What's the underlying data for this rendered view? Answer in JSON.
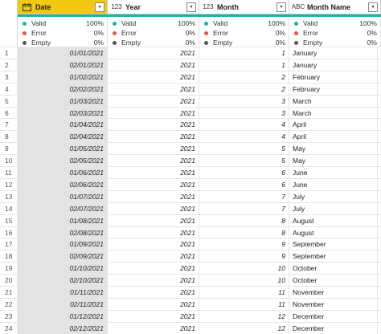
{
  "columns": [
    {
      "name": "Date",
      "type_icon": "calendar-icon",
      "selected": true
    },
    {
      "name": "Year",
      "type_icon": "123",
      "selected": false
    },
    {
      "name": "Month",
      "type_icon": "123",
      "selected": false
    },
    {
      "name": "Month Name",
      "type_icon": "ABC",
      "selected": false
    }
  ],
  "quality_labels": {
    "valid": "Valid",
    "error": "Error",
    "empty": "Empty"
  },
  "quality": [
    {
      "valid": "100%",
      "error": "0%",
      "empty": "0%"
    },
    {
      "valid": "100%",
      "error": "0%",
      "empty": "0%"
    },
    {
      "valid": "100%",
      "error": "0%",
      "empty": "0%"
    },
    {
      "valid": "100%",
      "error": "0%",
      "empty": "0%"
    }
  ],
  "colors": {
    "valid": "#1cb2a8",
    "error": "#e8544c",
    "empty": "#555555",
    "selected_header": "#f2c811"
  },
  "rows": [
    {
      "n": "1",
      "date": "01/01/2021",
      "year": "2021",
      "month": "1",
      "mname": "January"
    },
    {
      "n": "2",
      "date": "02/01/2021",
      "year": "2021",
      "month": "1",
      "mname": "January"
    },
    {
      "n": "3",
      "date": "01/02/2021",
      "year": "2021",
      "month": "2",
      "mname": "February"
    },
    {
      "n": "4",
      "date": "02/02/2021",
      "year": "2021",
      "month": "2",
      "mname": "February"
    },
    {
      "n": "5",
      "date": "01/03/2021",
      "year": "2021",
      "month": "3",
      "mname": "March"
    },
    {
      "n": "6",
      "date": "02/03/2021",
      "year": "2021",
      "month": "3",
      "mname": "March"
    },
    {
      "n": "7",
      "date": "01/04/2021",
      "year": "2021",
      "month": "4",
      "mname": "April"
    },
    {
      "n": "8",
      "date": "02/04/2021",
      "year": "2021",
      "month": "4",
      "mname": "April"
    },
    {
      "n": "9",
      "date": "01/05/2021",
      "year": "2021",
      "month": "5",
      "mname": "May"
    },
    {
      "n": "10",
      "date": "02/05/2021",
      "year": "2021",
      "month": "5",
      "mname": "May"
    },
    {
      "n": "11",
      "date": "01/06/2021",
      "year": "2021",
      "month": "6",
      "mname": "June"
    },
    {
      "n": "12",
      "date": "02/06/2021",
      "year": "2021",
      "month": "6",
      "mname": "June"
    },
    {
      "n": "13",
      "date": "01/07/2021",
      "year": "2021",
      "month": "7",
      "mname": "July"
    },
    {
      "n": "14",
      "date": "02/07/2021",
      "year": "2021",
      "month": "7",
      "mname": "July"
    },
    {
      "n": "15",
      "date": "01/08/2021",
      "year": "2021",
      "month": "8",
      "mname": "August"
    },
    {
      "n": "16",
      "date": "02/08/2021",
      "year": "2021",
      "month": "8",
      "mname": "August"
    },
    {
      "n": "17",
      "date": "01/09/2021",
      "year": "2021",
      "month": "9",
      "mname": "September"
    },
    {
      "n": "18",
      "date": "02/09/2021",
      "year": "2021",
      "month": "9",
      "mname": "September"
    },
    {
      "n": "19",
      "date": "01/10/2021",
      "year": "2021",
      "month": "10",
      "mname": "October"
    },
    {
      "n": "20",
      "date": "02/10/2021",
      "year": "2021",
      "month": "10",
      "mname": "October"
    },
    {
      "n": "21",
      "date": "01/11/2021",
      "year": "2021",
      "month": "11",
      "mname": "November"
    },
    {
      "n": "22",
      "date": "02/11/2021",
      "year": "2021",
      "month": "11",
      "mname": "November"
    },
    {
      "n": "23",
      "date": "01/12/2021",
      "year": "2021",
      "month": "12",
      "mname": "December"
    },
    {
      "n": "24",
      "date": "02/12/2021",
      "year": "2021",
      "month": "12",
      "mname": "December"
    }
  ]
}
